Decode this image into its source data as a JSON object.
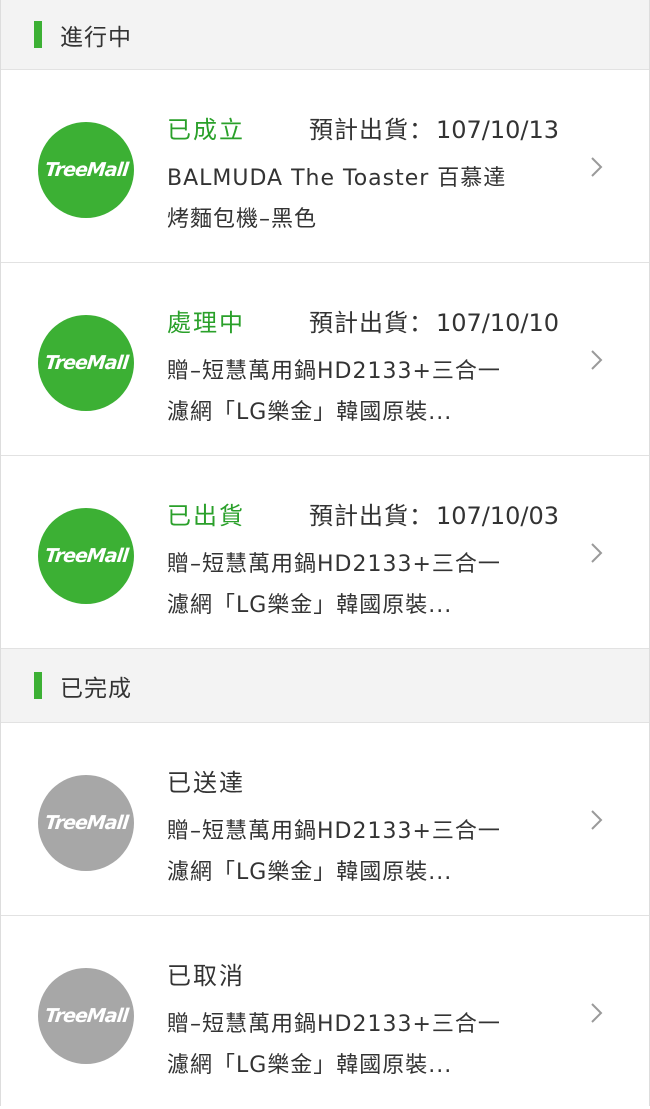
{
  "sections": [
    {
      "title": "進行中",
      "orders": [
        {
          "logo": "TreeMall",
          "status": "已成立",
          "ship_label": "預計出貨：",
          "ship_date": "107/10/13",
          "product_line1": "BALMUDA The Toaster 百慕達",
          "product_line2": "烤麵包機–黑色"
        },
        {
          "logo": "TreeMall",
          "status": "處理中",
          "ship_label": "預計出貨：",
          "ship_date": "107/10/10",
          "product_line1": "贈–短慧萬用鍋HD2133+三合一",
          "product_line2": "濾網「LG樂金」韓國原裝..."
        },
        {
          "logo": "TreeMall",
          "status": "已出貨",
          "ship_label": "預計出貨：",
          "ship_date": "107/10/03",
          "product_line1": "贈–短慧萬用鍋HD2133+三合一",
          "product_line2": "濾網「LG樂金」韓國原裝..."
        }
      ]
    },
    {
      "title": "已完成",
      "orders": [
        {
          "logo": "TreeMall",
          "status": "已送達",
          "product_line1": "贈–短慧萬用鍋HD2133+三合一",
          "product_line2": "濾網「LG樂金」韓國原裝..."
        },
        {
          "logo": "TreeMall",
          "status": "已取消",
          "product_line1": "贈–短慧萬用鍋HD2133+三合一",
          "product_line2": "濾網「LG樂金」韓國原裝..."
        }
      ]
    }
  ],
  "colors": {
    "accent": "#3cb034",
    "status_active": "#2aa02a",
    "logo_inactive": "#a7a7a7",
    "header_bg": "#f3f3f3"
  },
  "icons": {
    "row_action": "chevron-right-icon",
    "store_logo": "treemall-logo"
  }
}
